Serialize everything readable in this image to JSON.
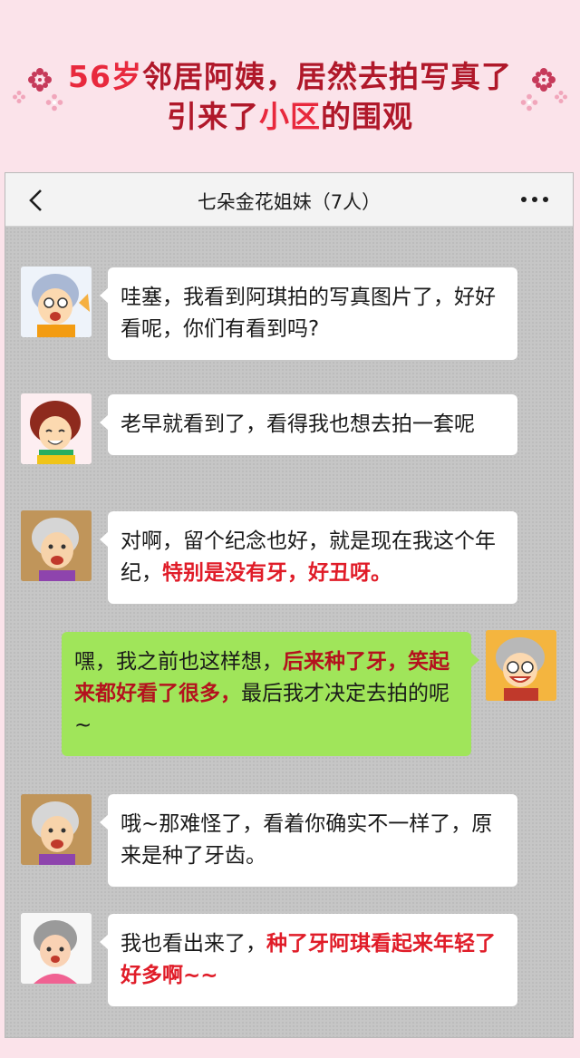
{
  "banner": {
    "line1_age": "56岁",
    "line1_rest": "邻居阿姨，居然去拍写真了",
    "line2_a": "引来了",
    "line2_b": "小区",
    "line2_c": "的围观"
  },
  "chat": {
    "title": "七朵金花姐妹（7人）"
  },
  "messages": [
    {
      "side": "left",
      "segments": [
        {
          "text": "哇塞，我看到阿琪拍的写真图片了，好好看呢，你们有看到吗?",
          "highlight": false
        }
      ]
    },
    {
      "side": "left",
      "segments": [
        {
          "text": "老早就看到了，看得我也想去拍一套呢",
          "highlight": false
        }
      ]
    },
    {
      "side": "left",
      "segments": [
        {
          "text": "对啊，留个纪念也好，就是现在我这个年纪，",
          "highlight": false
        },
        {
          "text": "特别是没有牙，好丑呀。",
          "highlight": true
        }
      ]
    },
    {
      "side": "right",
      "segments": [
        {
          "text": "嘿，我之前也这样想，",
          "highlight": false
        },
        {
          "text": "后来种了牙，笑起来都好看了很多，",
          "highlight": true
        },
        {
          "text": "最后我才决定去拍的呢~",
          "highlight": false
        }
      ]
    },
    {
      "side": "left",
      "segments": [
        {
          "text": "哦~那难怪了，看着你确实不一样了，原来是种了牙齿。",
          "highlight": false
        }
      ]
    },
    {
      "side": "left",
      "segments": [
        {
          "text": "我也看出来了，",
          "highlight": false
        },
        {
          "text": "种了牙阿琪看起来年轻了好多啊~~",
          "highlight": true
        }
      ]
    }
  ],
  "colors": {
    "banner_bg": "#fbe3ea",
    "title_red": "#e8293d",
    "title_dark_red": "#b0182a",
    "bubble_green": "#a0e55a",
    "highlight_red": "#e01c28"
  },
  "icons": [
    "back-chevron-icon",
    "more-dots-icon",
    "flower-ornament-icon"
  ]
}
